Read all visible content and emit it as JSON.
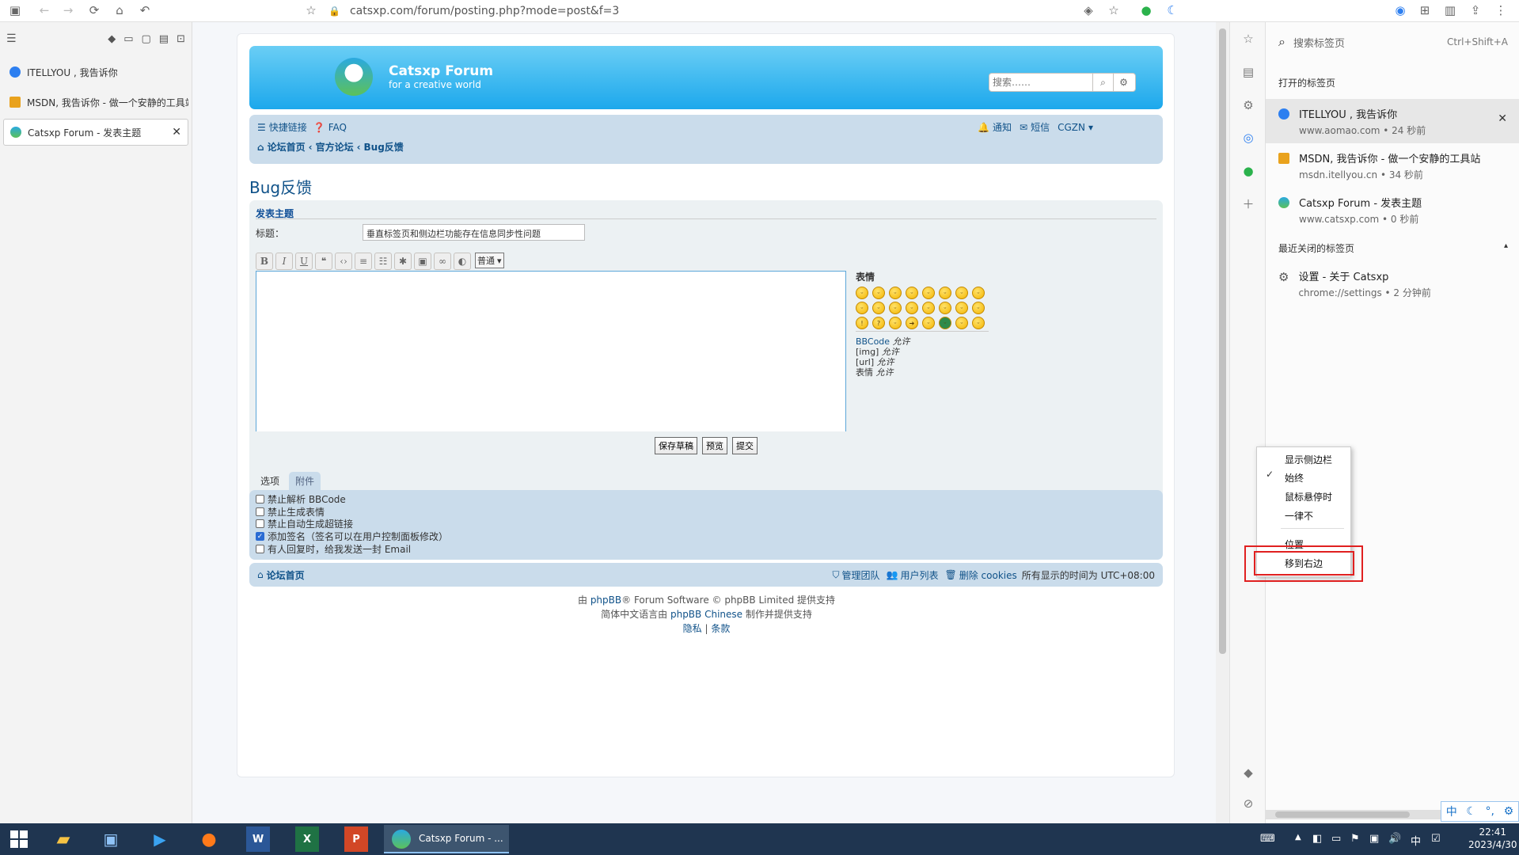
{
  "browser": {
    "url": "catsxp.com/forum/posting.php?mode=post&f=3"
  },
  "left_sidebar": {
    "tabs": [
      {
        "title": "ITELLYOU , 我告诉你",
        "active": false,
        "color": "#2d7ff0"
      },
      {
        "title": "MSDN, 我告诉你 - 做一个安静的工具站",
        "active": false,
        "color": "#e9a21d"
      },
      {
        "title": "Catsxp Forum - 发表主题",
        "active": true,
        "color": "#2bb24c"
      }
    ]
  },
  "forum": {
    "site_name": "Catsxp Forum",
    "site_desc": "for a creative world",
    "search_placeholder": "搜索……",
    "nav": {
      "quick_links": "快捷链接",
      "faq": "FAQ",
      "notifications": "通知",
      "messages": "短信",
      "user": "CGZN",
      "crumb_home": "论坛首页",
      "crumb_official": "官方论坛",
      "crumb_bug": "Bug反馈"
    },
    "page_title": "Bug反馈",
    "section_title": "发表主题",
    "subject_label": "标题：",
    "subject_value": "垂直标签页和侧边栏功能存在信息同步性问题",
    "font_size_option": "普通",
    "smilies_title": "表情",
    "bbcode_info": [
      {
        "label": "BBCode",
        "state": "允许"
      },
      {
        "label": "[img]",
        "state": "允许"
      },
      {
        "label": "[url]",
        "state": "允许"
      },
      {
        "label": "表情",
        "state": "允许"
      }
    ],
    "buttons": {
      "save_draft": "保存草稿",
      "preview": "预览",
      "submit": "提交"
    },
    "tabs": {
      "options": "选项",
      "attachments": "附件"
    },
    "options": [
      {
        "label": "禁止解析 BBCode",
        "checked": false
      },
      {
        "label": "禁止生成表情",
        "checked": false
      },
      {
        "label": "禁止自动生成超链接",
        "checked": false
      },
      {
        "label": "添加签名（签名可以在用户控制面板修改）",
        "checked": true
      },
      {
        "label": "有人回复时，给我发送一封 Email",
        "checked": false
      }
    ],
    "footer": {
      "home": "论坛首页",
      "team": "管理团队",
      "members": "用户列表",
      "delete_cookies": "删除 cookies",
      "timezone": "所有显示的时间为 UTC+08:00",
      "credit_prefix": "由",
      "credit_phpbb": "phpBB",
      "credit_suffix": "® Forum Software © phpBB Limited 提供支持",
      "cn_prefix": "简体中文语言由",
      "cn_link": "phpBB Chinese",
      "cn_suffix": "制作并提供支持",
      "privacy": "隐私",
      "sep": "|",
      "terms": "条款"
    }
  },
  "tab_panel": {
    "search_placeholder": "搜索标签页",
    "search_shortcut": "Ctrl+Shift+A",
    "open_tabs_header": "打开的标签页",
    "open_tabs": [
      {
        "title": "ITELLYOU , 我告诉你",
        "sub": "www.aomao.com • 24 秒前",
        "selected": true
      },
      {
        "title": "MSDN, 我告诉你 - 做一个安静的工具站",
        "sub": "msdn.itellyou.cn • 34 秒前",
        "selected": false
      },
      {
        "title": "Catsxp Forum - 发表主题",
        "sub": "www.catsxp.com • 0 秒前",
        "selected": false
      }
    ],
    "recent_header": "最近关闭的标签页",
    "recent": [
      {
        "title": "设置 - 关于 Catsxp",
        "sub": "chrome://settings • 2 分钟前"
      }
    ]
  },
  "context_menu": {
    "show_sidebar": "显示侧边栏",
    "always": "始终",
    "on_hover": "鼠标悬停时",
    "never": "一律不",
    "position": "位置",
    "move_right": "移到右边"
  },
  "ime": {
    "lang": "中"
  },
  "taskbar": {
    "active_title": "Catsxp Forum - ...",
    "time": "22:41",
    "date": "2023/4/30",
    "ime_lang": "中"
  },
  "colors": {
    "header_blue": "#12a3eb",
    "link_blue": "#105289",
    "highlight_red": "#e02020",
    "taskbar": "#1f3550"
  }
}
